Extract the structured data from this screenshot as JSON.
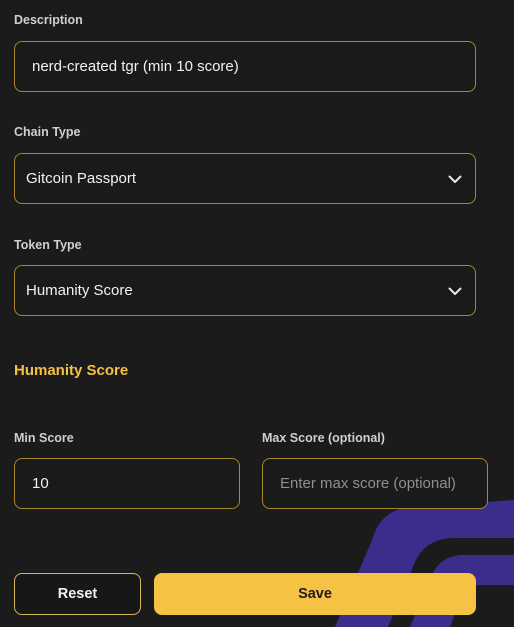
{
  "description": {
    "label": "Description",
    "value": "nerd-created tgr (min 10 score)"
  },
  "chain_type": {
    "label": "Chain Type",
    "selected": "Gitcoin Passport",
    "icon": "chevron-down-icon"
  },
  "token_type": {
    "label": "Token Type",
    "selected": "Humanity Score",
    "icon": "chevron-down-icon"
  },
  "section": {
    "title": "Humanity Score"
  },
  "min_score": {
    "label": "Min Score",
    "value": "10"
  },
  "max_score": {
    "label": "Max Score (optional)",
    "value": "",
    "placeholder": "Enter max score (optional)"
  },
  "actions": {
    "reset_label": "Reset",
    "save_label": "Save"
  },
  "colors": {
    "background": "#1b1b1b",
    "border_gold": "#a9862a",
    "accent_yellow": "#f6c244",
    "background_art": "#3b2d8c"
  }
}
